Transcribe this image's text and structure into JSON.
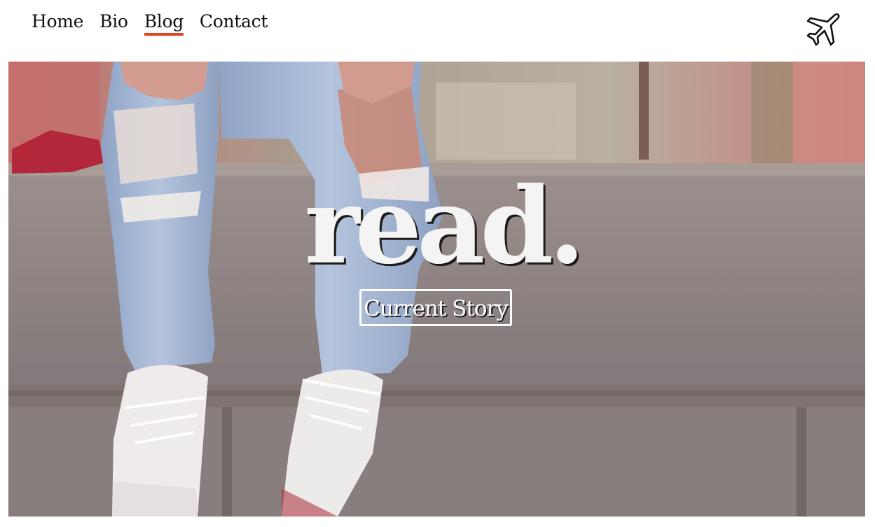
{
  "nav": {
    "links": [
      {
        "label": "Home",
        "active": false
      },
      {
        "label": "Bio",
        "active": false
      },
      {
        "label": "Blog",
        "active": true
      },
      {
        "label": "Contact",
        "active": false
      }
    ],
    "logo_icon": "airplane-icon"
  },
  "hero": {
    "title": "read.",
    "cta_label": "Current Story",
    "image": "photo of person in ripped jeans and white sneakers sitting on a concrete wall"
  },
  "colors": {
    "accent": "#e0461b",
    "wall": "#8d8584",
    "denim": "#a7bad6",
    "text_light": "#f4f4f4"
  }
}
